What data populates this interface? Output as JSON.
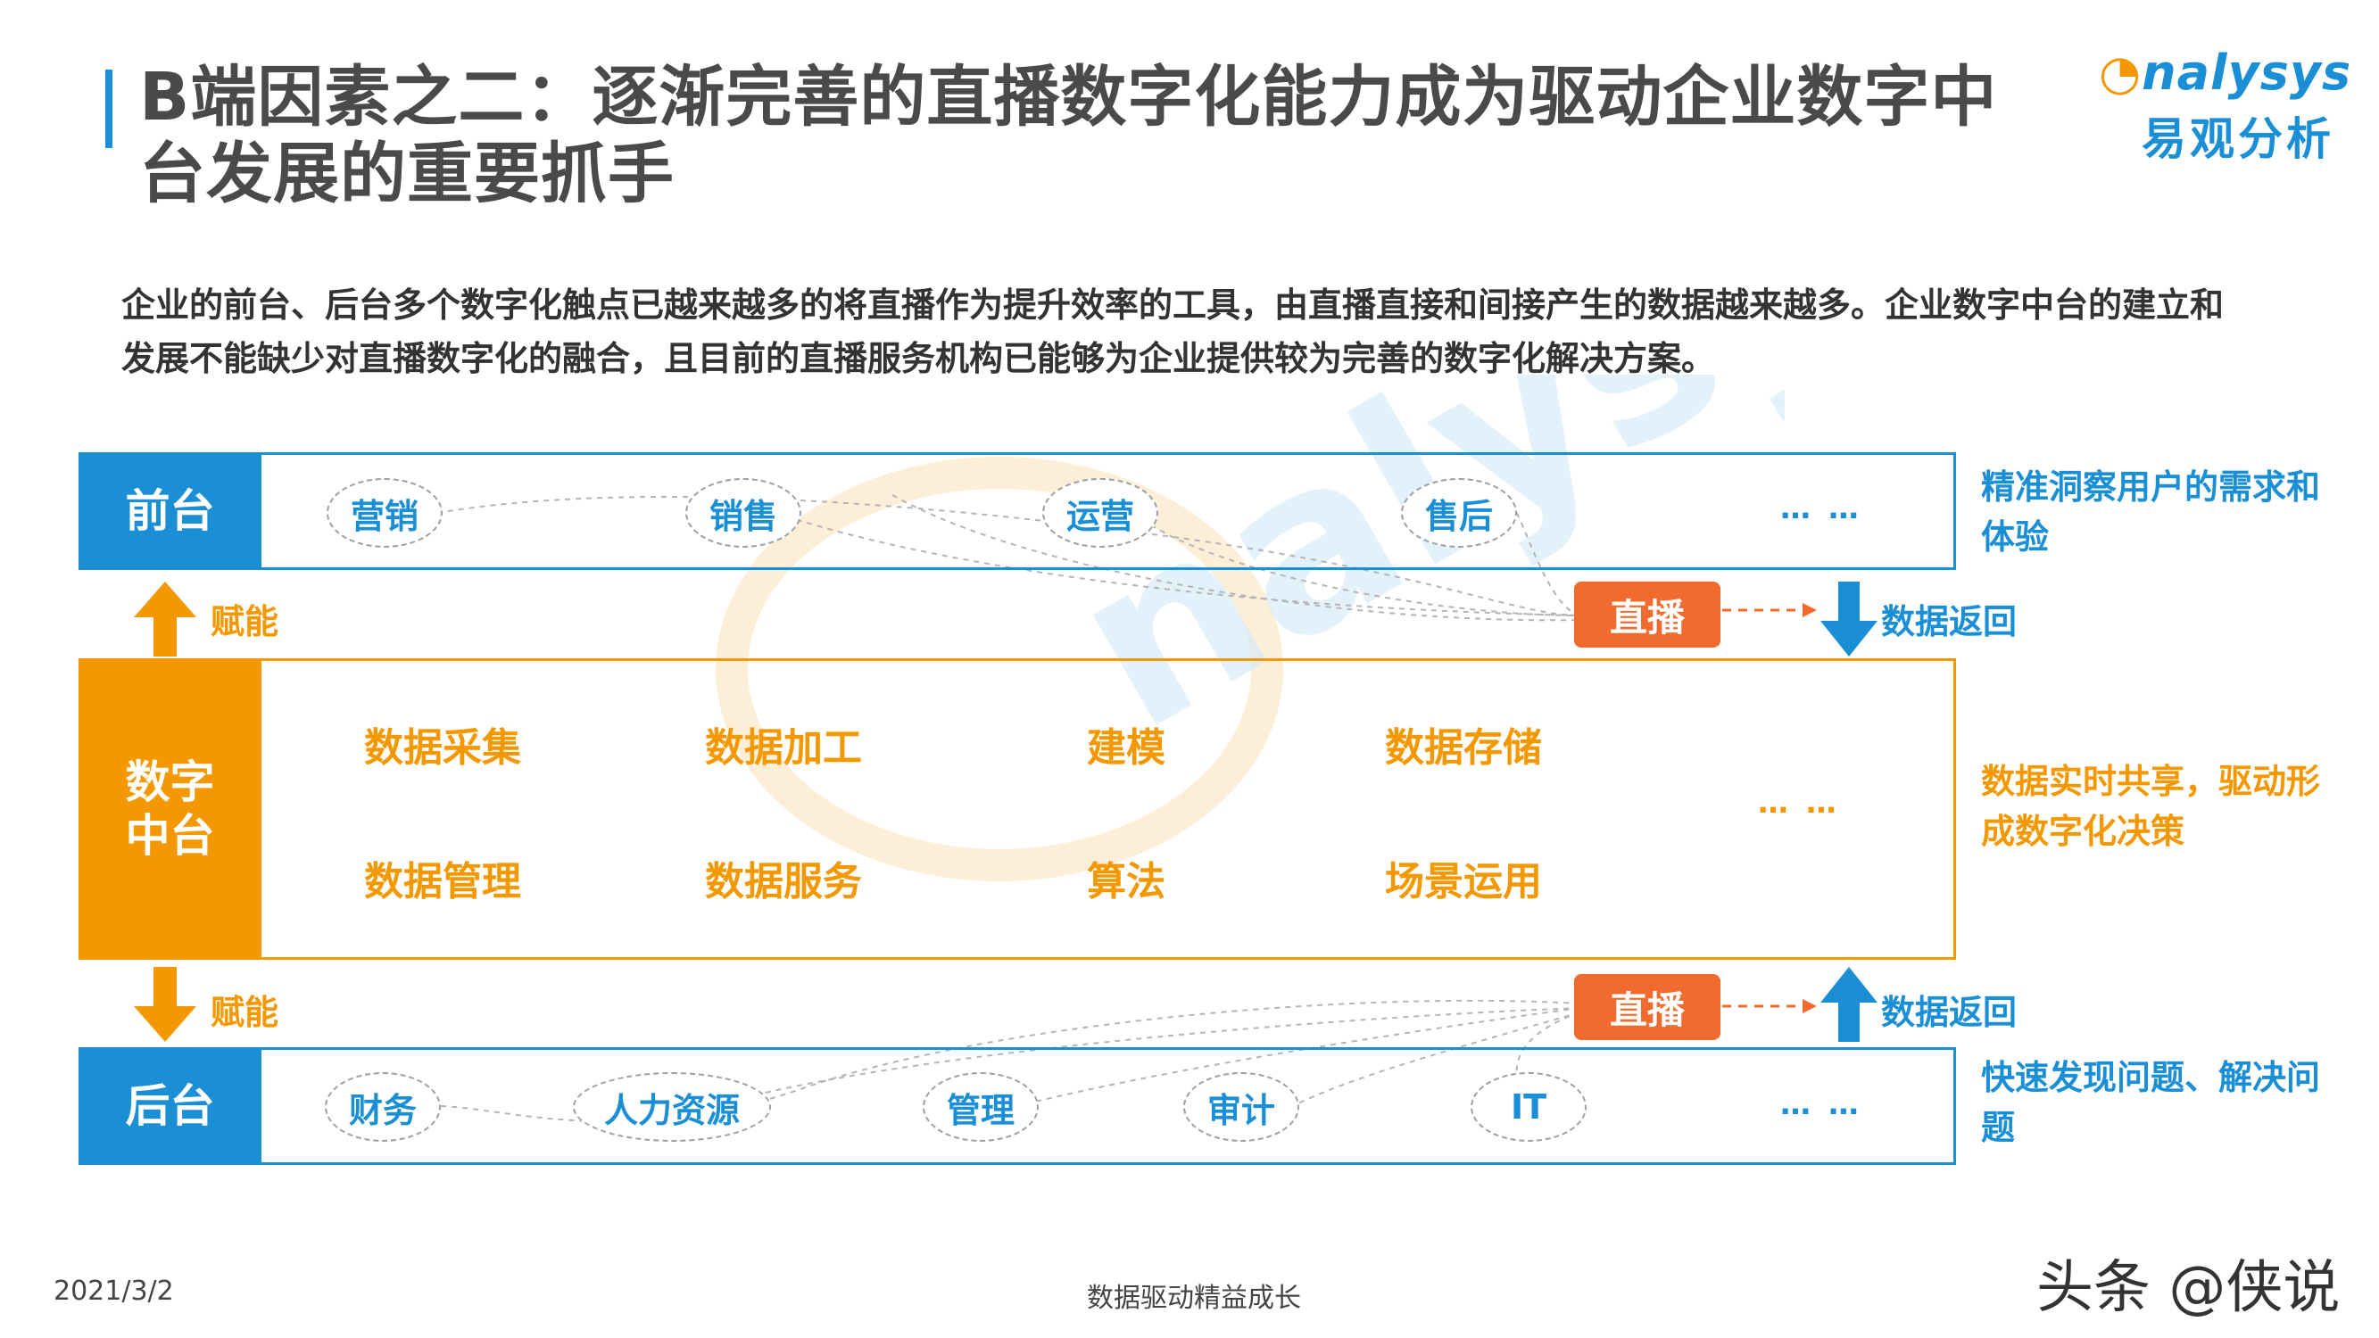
{
  "header": {
    "title": "B端因素之二：逐渐完善的直播数字化能力成为驱动企业数字中台发展的重要抓手",
    "logo_en": "nalysys",
    "logo_cn": "易观分析"
  },
  "description": "企业的前台、后台多个数字化触点已越来越多的将直播作为提升效率的工具，由直播直接和间接产生的数据越来越多。企业数字中台的建立和发展不能缺少对直播数字化的融合，且目前的直播服务机构已能够为企业提供较为完善的数字化解决方案。",
  "front": {
    "label": "前台",
    "items": [
      "营销",
      "销售",
      "运营",
      "售后"
    ],
    "more": "… …",
    "side_text": "精准洞察用户的需求和体验"
  },
  "connector_top": {
    "empower": "赋能",
    "live": "直播",
    "data_return": "数据返回"
  },
  "middle": {
    "label": "数字中台",
    "items_row1": [
      "数据采集",
      "数据加工",
      "建模",
      "数据存储"
    ],
    "items_row2": [
      "数据管理",
      "数据服务",
      "算法",
      "场景运用"
    ],
    "more": "… …",
    "side_text": "数据实时共享，驱动形成数字化决策"
  },
  "connector_bottom": {
    "empower": "赋能",
    "live": "直播",
    "data_return": "数据返回"
  },
  "back": {
    "label": "后台",
    "items": [
      "财务",
      "人力资源",
      "管理",
      "审计",
      "IT"
    ],
    "more": "… …",
    "side_text": "快速发现问题、解决问题"
  },
  "footer": {
    "date": "2021/3/2",
    "slogan": "数据驱动精益成长",
    "credit": "头条 @侠说"
  },
  "colors": {
    "blue": "#1a8fd6",
    "orange": "#f39800",
    "live_red": "#f26b2e"
  }
}
